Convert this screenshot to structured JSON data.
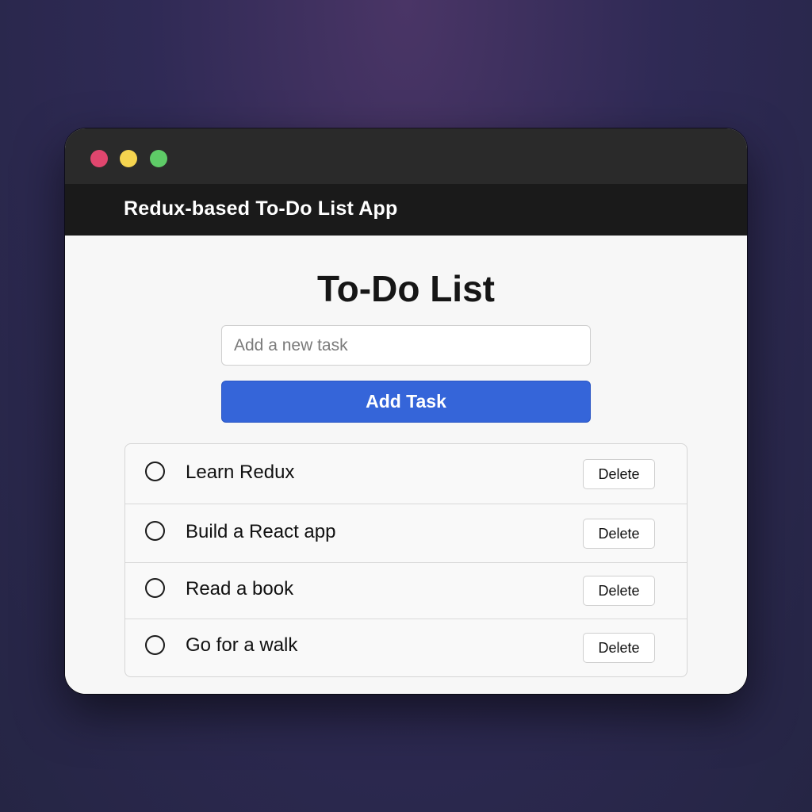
{
  "window": {
    "app_title": "Redux-based To-Do List App",
    "traffic_lights": {
      "close_color": "#e0466e",
      "minimize_color": "#f5d44f",
      "zoom_color": "#5ecb67"
    }
  },
  "main": {
    "heading": "To-Do List",
    "input": {
      "placeholder": "Add a new task",
      "value": ""
    },
    "add_button_label": "Add Task",
    "accent_color": "#3565d9"
  },
  "tasks": [
    {
      "label": "Learn Redux",
      "completed": false,
      "delete_label": "Delete"
    },
    {
      "label": "Build a React app",
      "completed": false,
      "delete_label": "Delete"
    },
    {
      "label": "Read a book",
      "completed": false,
      "delete_label": "Delete"
    },
    {
      "label": "Go for a walk",
      "completed": false,
      "delete_label": "Delete"
    }
  ]
}
